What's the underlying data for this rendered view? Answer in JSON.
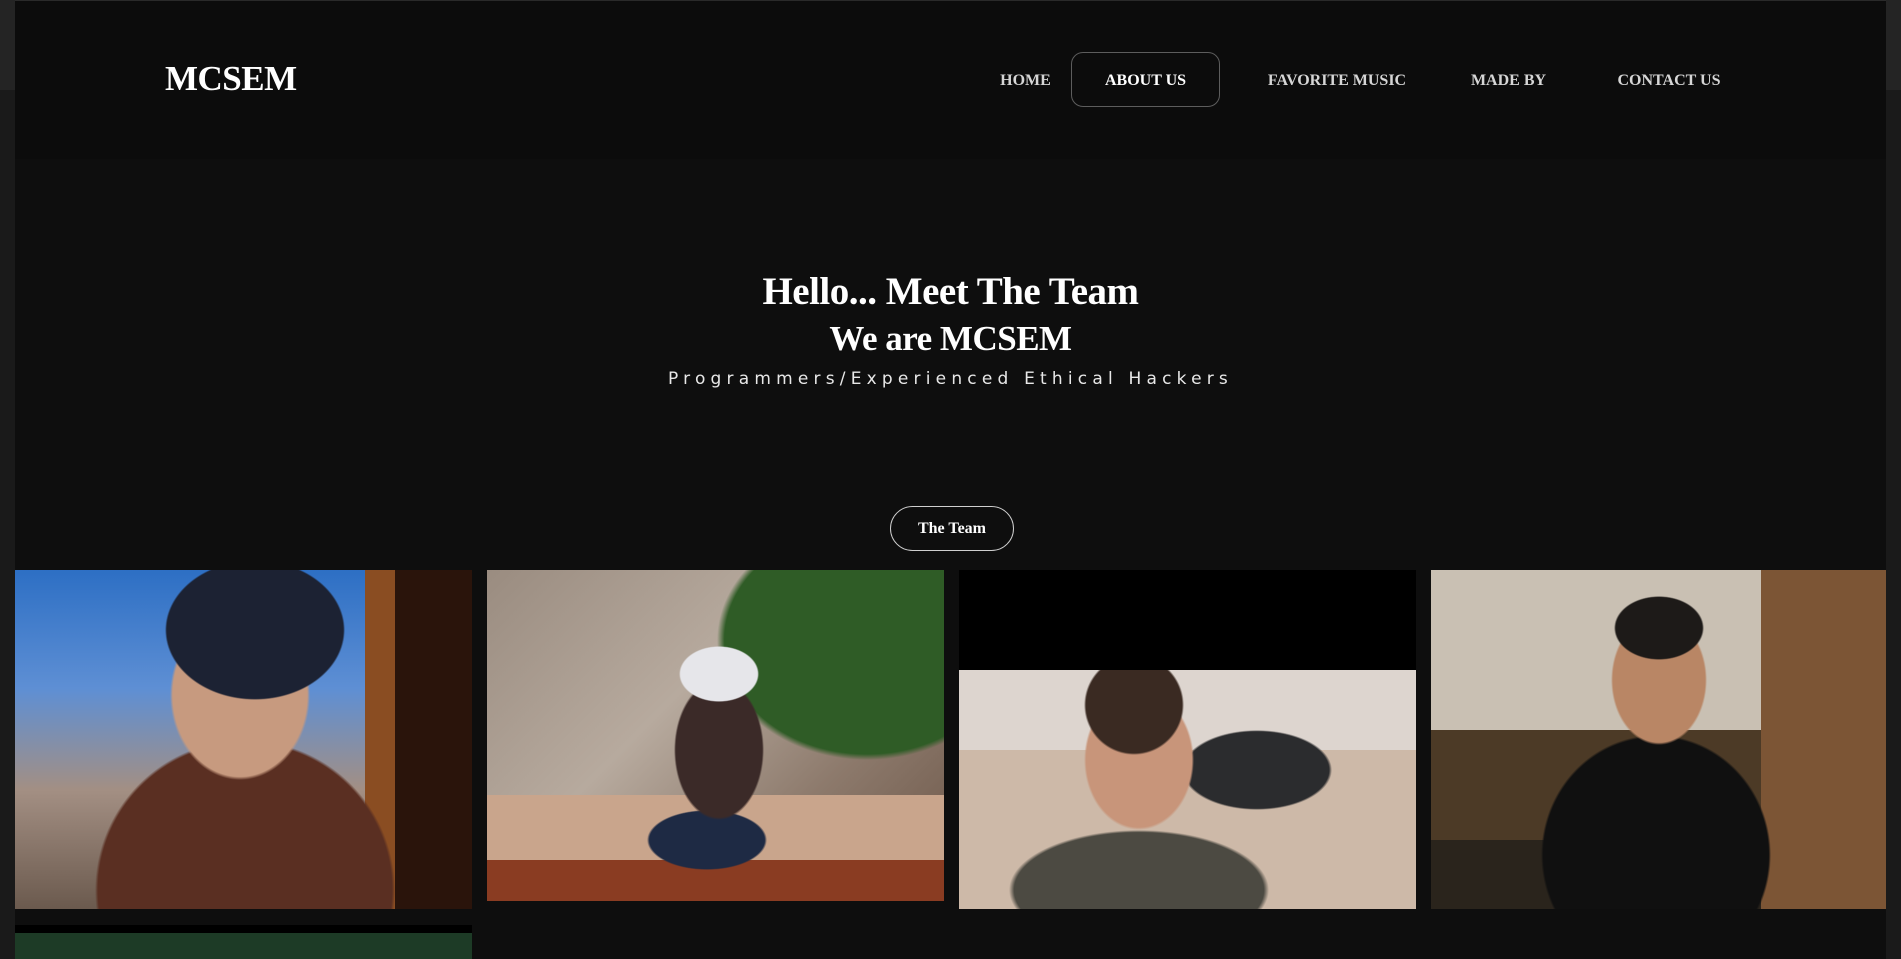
{
  "logo": "MCSEM",
  "nav": {
    "items": [
      {
        "label": "HOME"
      },
      {
        "label": "ABOUT US",
        "active": true
      },
      {
        "label": "FAVORITE MUSIC"
      },
      {
        "label": "MADE BY"
      },
      {
        "label": "CONTACT US"
      }
    ]
  },
  "hero": {
    "title": "Hello... Meet The Team",
    "subtitle": "We are MCSEM",
    "tagline": "Programmers/Experienced Ethical Hackers"
  },
  "team_button": "The Team",
  "colors": {
    "background": "#0e0e0e",
    "header": "#0c0c0c",
    "text": "#ffffff"
  }
}
